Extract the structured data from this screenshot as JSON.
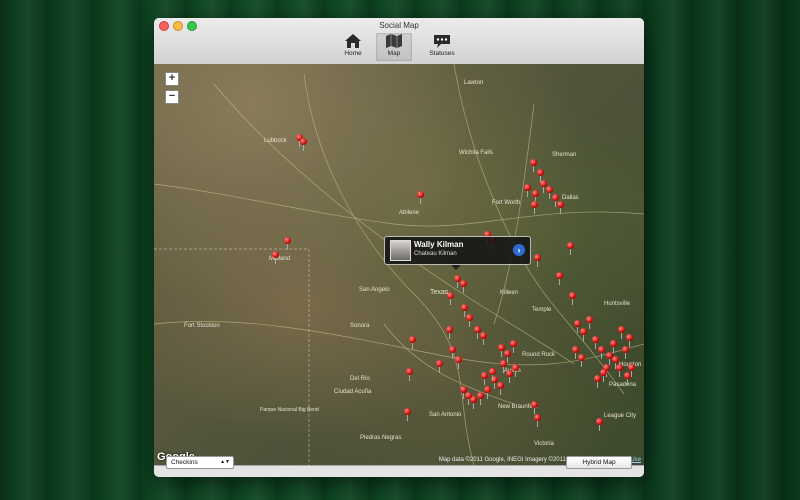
{
  "window": {
    "title": "Social Map"
  },
  "toolbar": {
    "home_label": "Home",
    "map_label": "Map",
    "statuses_label": "Statuses"
  },
  "map": {
    "zoom_in": "+",
    "zoom_out": "−",
    "google_logo": "Google",
    "attribution": "Map data ©2011 Google, INEGI Imagery ©2011 TerraMetrics",
    "terms_link": "Terms of Use",
    "callout": {
      "name": "Wally Kilman",
      "place": "Chateau Kilman"
    },
    "labels": [
      "Lubbock",
      "Wichita Falls",
      "Sherman",
      "Abilene",
      "Fort Worth",
      "Dallas",
      "Midland",
      "San Angelo",
      "Texas",
      "Killeen",
      "Temple",
      "Austin",
      "Round Rock",
      "New Braunfels",
      "San Antonio",
      "Victoria",
      "Houston",
      "Huntsville",
      "Pasadena",
      "League City",
      "Ciudad Acuña",
      "Piedras Negras",
      "Parque Nacional Big Bend",
      "Del Rio",
      "Fort Stockton",
      "Sonora",
      "Lawton"
    ]
  },
  "bottombar": {
    "filter_value": "Checkins",
    "map_type_button": "Hybrid Map"
  },
  "colors": {
    "pin": "#c40000",
    "callout_bg": "#1a1a1a",
    "disclosure": "#2f6ad1"
  }
}
